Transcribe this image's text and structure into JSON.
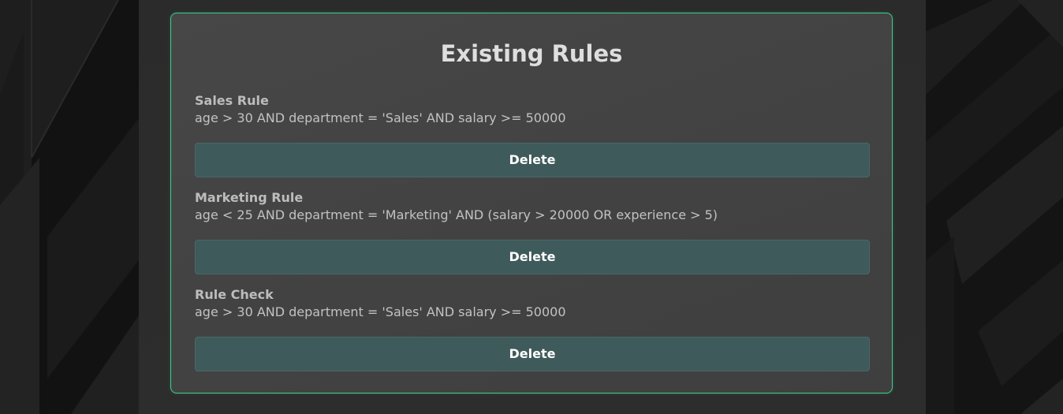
{
  "page": {
    "title": "Existing Rules"
  },
  "rules": [
    {
      "name": "Sales Rule",
      "expression": "age > 30 AND department = 'Sales' AND salary >= 50000",
      "delete_label": "Delete"
    },
    {
      "name": "Marketing Rule",
      "expression": "age < 25 AND department = 'Marketing' AND (salary > 20000 OR experience > 5)",
      "delete_label": "Delete"
    },
    {
      "name": "Rule Check",
      "expression": "age > 30 AND department = 'Sales' AND salary >= 50000",
      "delete_label": "Delete"
    }
  ],
  "colors": {
    "accent_border": "#3ecf8e",
    "card_background": "#454545",
    "button_background": "#3f5a5a",
    "page_background": "#161616"
  }
}
